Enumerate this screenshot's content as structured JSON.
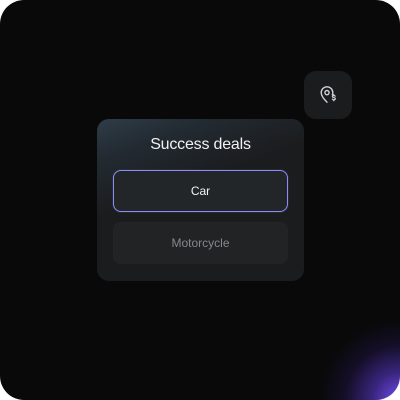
{
  "widget": {
    "icon": "location-pin-dollar-icon",
    "title": "Success deals",
    "options": [
      {
        "label": "Car",
        "selected": true
      },
      {
        "label": "Motorcycle",
        "selected": false
      }
    ]
  },
  "colors": {
    "background": "#090909",
    "card": "#1b1c1e",
    "selected_border": "#8c8cf2",
    "accent_glow": "#7850ff",
    "text_primary": "#f0f1f3",
    "text_muted": "#85878b"
  }
}
